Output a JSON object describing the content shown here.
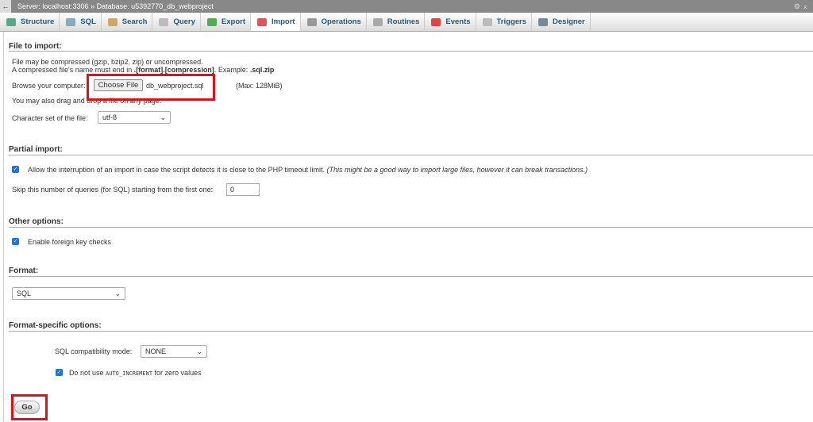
{
  "topbar": {
    "back": "←",
    "server": "Server: localhost:3306",
    "sep": "»",
    "database": "Database: u5392770_db_webproject",
    "settings_icon": "⚙",
    "collapse_icon": "⌅"
  },
  "tabs": [
    {
      "label": "Structure",
      "color": "#5a8"
    },
    {
      "label": "SQL",
      "color": "#8ab"
    },
    {
      "label": "Search",
      "color": "#ca6"
    },
    {
      "label": "Query",
      "color": "#bbb"
    },
    {
      "label": "Export",
      "color": "#5a5"
    },
    {
      "label": "Import",
      "color": "#d55"
    },
    {
      "label": "Operations",
      "color": "#999"
    },
    {
      "label": "Routines",
      "color": "#aaa"
    },
    {
      "label": "Events",
      "color": "#d44"
    },
    {
      "label": "Triggers",
      "color": "#bbb"
    },
    {
      "label": "Designer",
      "color": "#789"
    }
  ],
  "file": {
    "title": "File to import:",
    "line1": "File may be compressed (gzip, bzip2, zip) or uncompressed.",
    "line2a": "A compressed file's name must end in ",
    "line2b": ".[format].[compression]",
    "line2c": ". Example: ",
    "line2d": ".sql.zip",
    "browse_label": "Browse your computer:",
    "choose_button": "Choose File",
    "file_name": "db_webproject.sql",
    "max": "(Max: 128MiB)",
    "drag": "You may also drag and drop a file on any page.",
    "charset_label": "Character set of the file:",
    "charset": "utf-8"
  },
  "partial": {
    "title": "Partial import:",
    "allow": "Allow the interruption of an import in case the script detects it is close to the PHP timeout limit.",
    "allow_note": "(This might be a good way to import large files, however it can break transactions.)",
    "skip_label": "Skip this number of queries (for SQL) starting from the first one:",
    "skip_value": "0"
  },
  "other": {
    "title": "Other options:",
    "fk": "Enable foreign key checks"
  },
  "format": {
    "title": "Format:",
    "value": "SQL"
  },
  "specific": {
    "title": "Format-specific options:",
    "compat_label": "SQL compatibility mode:",
    "compat": "NONE",
    "autoinc_a": "Do not use ",
    "autoinc_code": "AUTO_INCREMENT",
    "autoinc_b": " for zero values"
  },
  "go": "Go"
}
